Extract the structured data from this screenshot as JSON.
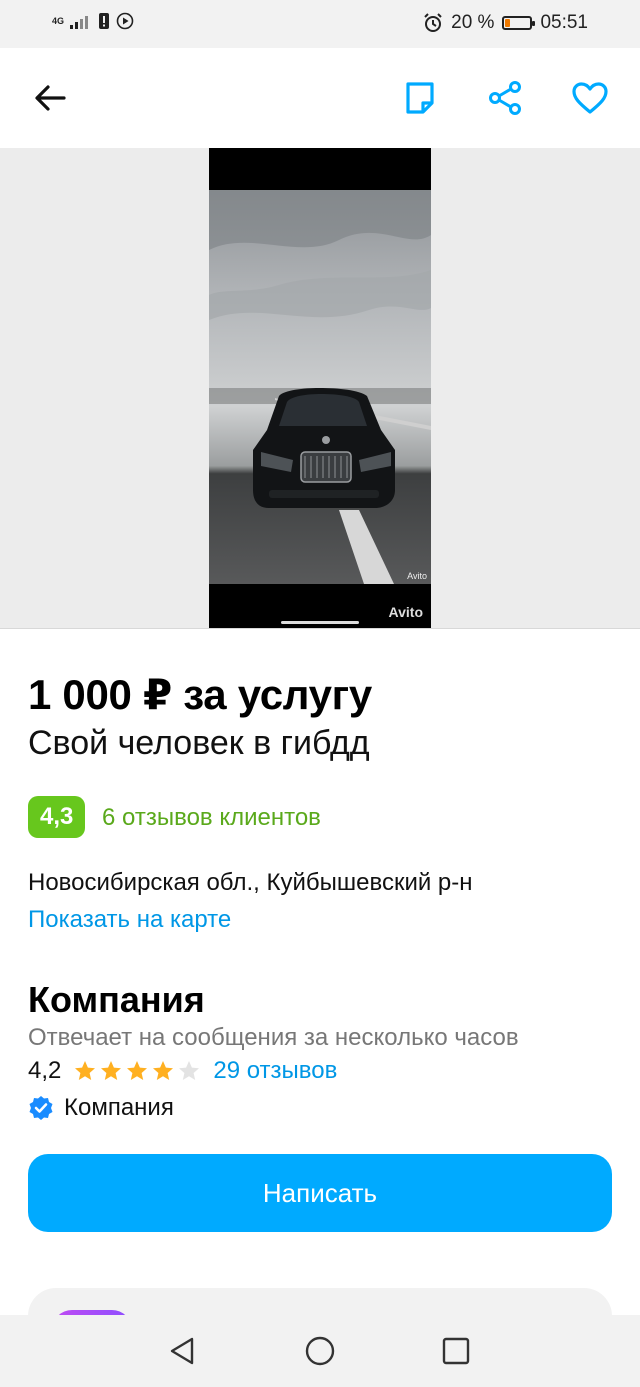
{
  "status_bar": {
    "network": "4G",
    "battery_percent": "20 %",
    "time": "05:51",
    "icons": [
      "signal-icon",
      "sim-alert-icon",
      "play-icon",
      "alarm-icon",
      "battery-icon"
    ]
  },
  "app_bar": {
    "icons": [
      "back-arrow-icon",
      "note-icon",
      "share-icon",
      "heart-icon"
    ]
  },
  "gallery": {
    "watermark_small": "Avito",
    "watermark": "Avito"
  },
  "listing": {
    "price": "1 000 ₽ за услугу",
    "title": "Свой человек в гибдд",
    "rating": "4,3",
    "reviews_link": "6 отзывов клиентов",
    "location": "Новосибирская обл., Куйбышевский р-н",
    "map_link": "Показать на карте"
  },
  "seller": {
    "name": "Компания",
    "reply_time": "Отвечает на сообщения за несколько часов",
    "score": "4,2",
    "stars_filled": 4,
    "stars_total": 5,
    "reviews_link": "29 отзывов",
    "verified_label": "Компания"
  },
  "actions": {
    "write_button": "Написать"
  },
  "colors": {
    "accent_blue": "#00aaff",
    "link_blue": "#0097e6",
    "rating_green": "#67c71d",
    "star_gold": "#ffb021"
  }
}
